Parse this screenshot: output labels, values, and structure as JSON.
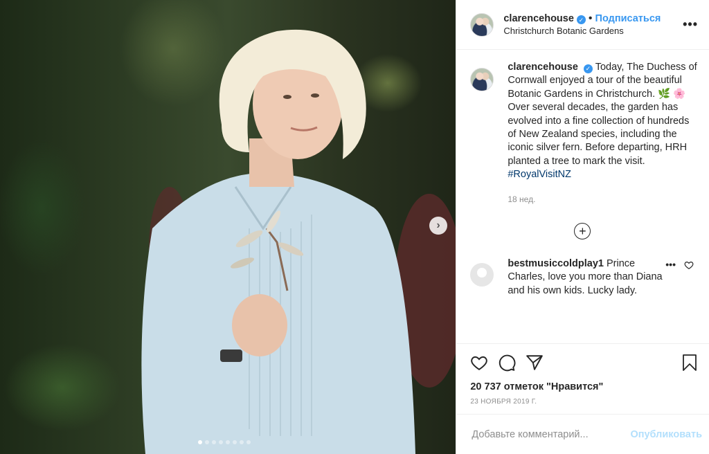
{
  "header": {
    "username": "clarencehouse",
    "separator": "•",
    "follow_label": "Подписаться",
    "location": "Christchurch Botanic Gardens",
    "more_icon": "•••"
  },
  "caption": {
    "username": "clarencehouse",
    "text_part1": "Today, The Duchess of Cornwall enjoyed a tour of the beautiful Botanic Gardens in Christchurch.",
    "emoji_leaf": "🌿",
    "emoji_flower": "🌸",
    "text_part2": "Over several decades, the garden has evolved into a fine collection of hundreds of New Zealand species, including the iconic silver fern. Before departing, HRH planted a tree to mark the visit.",
    "hashtag": "#RoyalVisitNZ",
    "time_ago": "18 нед.",
    "load_more_icon": "+"
  },
  "comment": {
    "username": "bestmusiccoldplay1",
    "text": "Prince Charles, love you more than Diana and his own kids. Lucky lady.",
    "options_icon": "•••"
  },
  "actions": {
    "likes": "20 737 отметок \"Нравится\"",
    "date": "23 ноября 2019 г."
  },
  "add_comment": {
    "placeholder": "Добавьте комментарий...",
    "publish_label": "Опубликовать"
  },
  "carousel": {
    "next_icon": "›",
    "slide_count": 8,
    "active_slide": 1
  },
  "colors": {
    "link_blue": "#3897f0",
    "publish_disabled": "#b2dffc",
    "hashtag": "#00376b",
    "muted": "#8e8e8e"
  }
}
